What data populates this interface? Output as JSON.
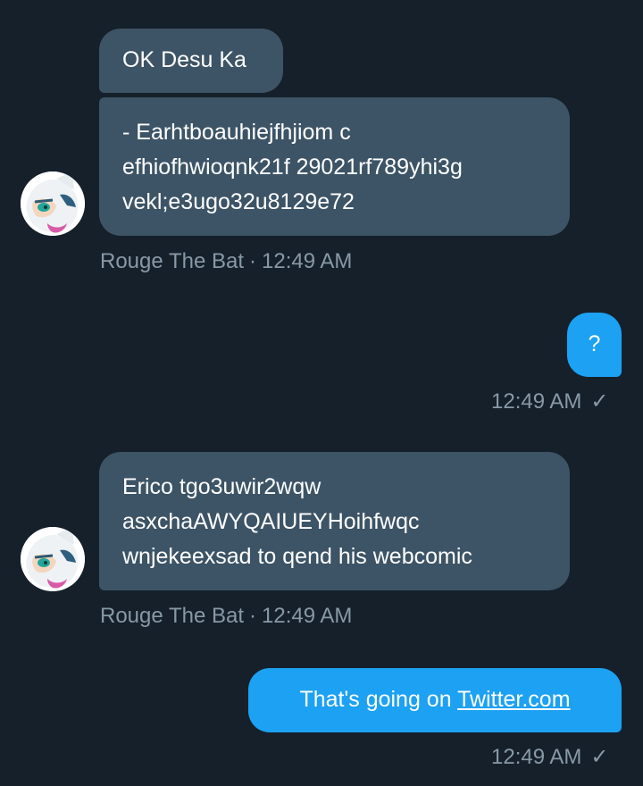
{
  "conversation": {
    "messages": [
      {
        "direction": "incoming",
        "text": "OK Desu Ka"
      },
      {
        "direction": "incoming",
        "lines": [
          "- Earhtboauhiejfhjiom c",
          "efhiofhwioqnk21f 29021rf789yhi3g",
          "vekl;e3ugo32u8129e72"
        ]
      },
      {
        "direction": "incoming_meta",
        "sender": "Rouge The Bat",
        "separator": "·",
        "time": "12:49 AM"
      },
      {
        "direction": "outgoing",
        "text": "?"
      },
      {
        "direction": "outgoing_meta",
        "time": "12:49 AM",
        "status": "✓"
      },
      {
        "direction": "incoming",
        "lines": [
          "Erico tgo3uwir2wqw",
          "asxchaAWYQAIUEYHoihfwqc",
          "wnjekeexsad to qend his webcomic"
        ]
      },
      {
        "direction": "incoming_meta",
        "sender": "Rouge The Bat",
        "separator": "·",
        "time": "12:49 AM"
      },
      {
        "direction": "outgoing",
        "prefix": "That's going on ",
        "link": "Twitter.com"
      },
      {
        "direction": "outgoing_meta",
        "time": "12:49 AM",
        "status": "✓"
      }
    ]
  },
  "colors": {
    "background": "#15202b",
    "incoming_bubble": "#3d5466",
    "outgoing_bubble": "#1da1f2",
    "meta_text": "#8899a6"
  },
  "icons": {
    "avatar": "rouge-the-bat-avatar",
    "read_receipt": "checkmark-icon"
  }
}
